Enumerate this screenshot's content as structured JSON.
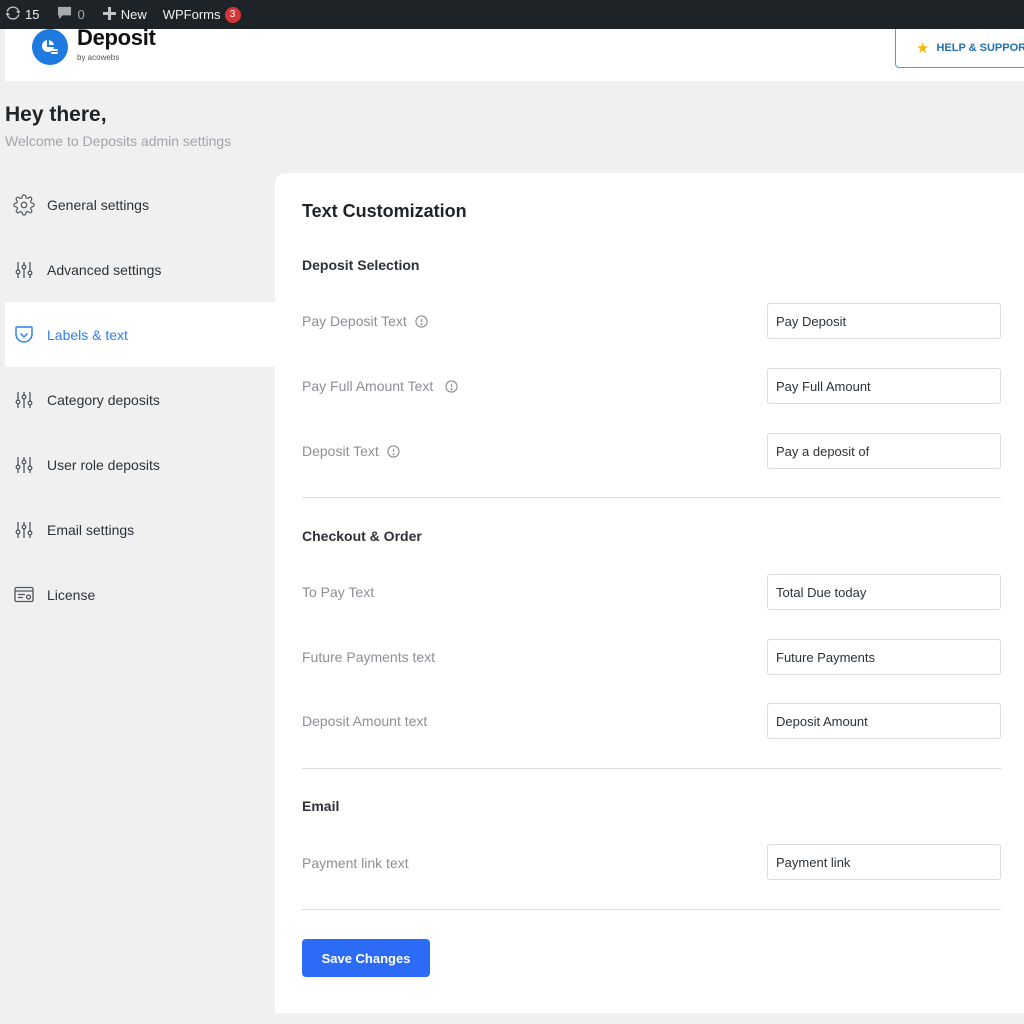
{
  "admin_bar": {
    "updates_count": "15",
    "comments_count": "0",
    "new_label": "New",
    "wpforms_label": "WPForms",
    "wpforms_badge": "3"
  },
  "header": {
    "brand": "Deposit",
    "brand_sub": "by acowebs",
    "help_label": "HELP & SUPPORT"
  },
  "greeting": {
    "title": "Hey there,",
    "subtitle": "Welcome to Deposits admin settings"
  },
  "sidebar": {
    "items": [
      {
        "label": "General settings",
        "icon": "gear-icon"
      },
      {
        "label": "Advanced settings",
        "icon": "sliders-icon"
      },
      {
        "label": "Labels & text",
        "icon": "pocket-icon",
        "active": true
      },
      {
        "label": "Category deposits",
        "icon": "sliders-icon"
      },
      {
        "label": "User role deposits",
        "icon": "sliders-icon"
      },
      {
        "label": "Email settings",
        "icon": "sliders-icon"
      },
      {
        "label": "License",
        "icon": "license-icon"
      }
    ]
  },
  "panel": {
    "title": "Text Customization",
    "sections": {
      "deposit_selection": {
        "title": "Deposit Selection",
        "pay_deposit": {
          "label": "Pay Deposit Text",
          "value": "Pay Deposit"
        },
        "pay_full": {
          "label": "Pay Full Amount Text",
          "value": "Pay Full Amount"
        },
        "deposit_text": {
          "label": "Deposit Text",
          "value": "Pay a deposit of"
        }
      },
      "checkout": {
        "title": "Checkout & Order",
        "to_pay": {
          "label": "To Pay Text",
          "value": "Total Due today"
        },
        "future": {
          "label": "Future Payments text",
          "value": "Future Payments"
        },
        "deposit_amount": {
          "label": "Deposit Amount text",
          "value": "Deposit Amount"
        }
      },
      "email": {
        "title": "Email",
        "payment_link": {
          "label": "Payment link text",
          "value": "Payment link"
        }
      }
    },
    "save_label": "Save Changes"
  },
  "colors": {
    "accent": "#2f80ed",
    "button": "#2c6bf5",
    "admin_bar": "#1d2327",
    "badge": "#d63638"
  }
}
